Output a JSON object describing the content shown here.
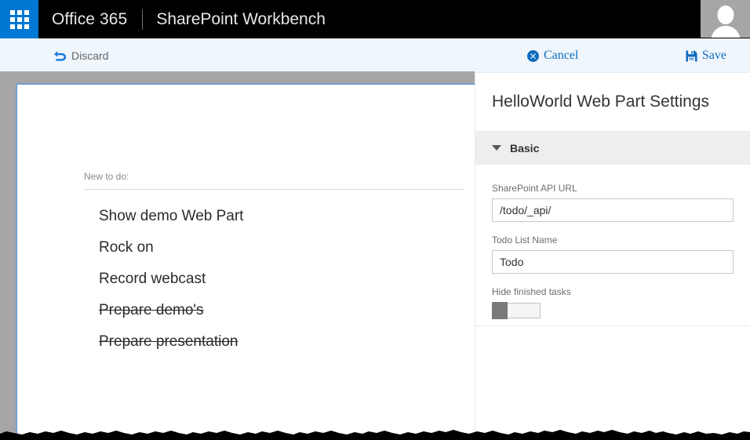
{
  "suite": {
    "waffle_icon": "app-launcher-grid-icon",
    "brand": "Office 365",
    "app_name": "SharePoint Workbench",
    "avatar_icon": "user-avatar-icon"
  },
  "command_bar": {
    "discard": {
      "label": "Discard",
      "icon": "undo-arrow-icon"
    },
    "cancel": {
      "label": "Cancel",
      "icon": "circle-x-icon"
    },
    "save": {
      "label": "Save",
      "icon": "floppy-disk-save-icon"
    },
    "accent_color": "#0f6cbd",
    "background_color": "#eff6fc"
  },
  "webpart": {
    "new_todo_placeholder": "New to do:",
    "new_todo_value": "",
    "items": [
      {
        "text": "Show demo Web Part",
        "done": false
      },
      {
        "text": "Rock on",
        "done": false
      },
      {
        "text": "Record webcast",
        "done": false
      },
      {
        "text": "Prepare demo's",
        "done": true
      },
      {
        "text": "Prepare presentation",
        "done": true
      }
    ]
  },
  "panel": {
    "title": "HelloWorld Web Part Settings",
    "group": {
      "label": "Basic",
      "expanded": true,
      "chevron_icon": "chevron-down-icon"
    },
    "fields": [
      {
        "label": "SharePoint API URL",
        "value": "/todo/_api/",
        "placeholder": ""
      },
      {
        "label": "Todo List Name",
        "value": "Todo",
        "placeholder": ""
      }
    ],
    "toggle": {
      "label": "Hide finished tasks",
      "state": "off"
    }
  },
  "colors": {
    "suite_bar": "#000000",
    "waffle": "#0078d4",
    "canvas_frame": "#a6a6a6",
    "canvas_accent": "#6f9cce",
    "group_header": "#eeeeee"
  }
}
